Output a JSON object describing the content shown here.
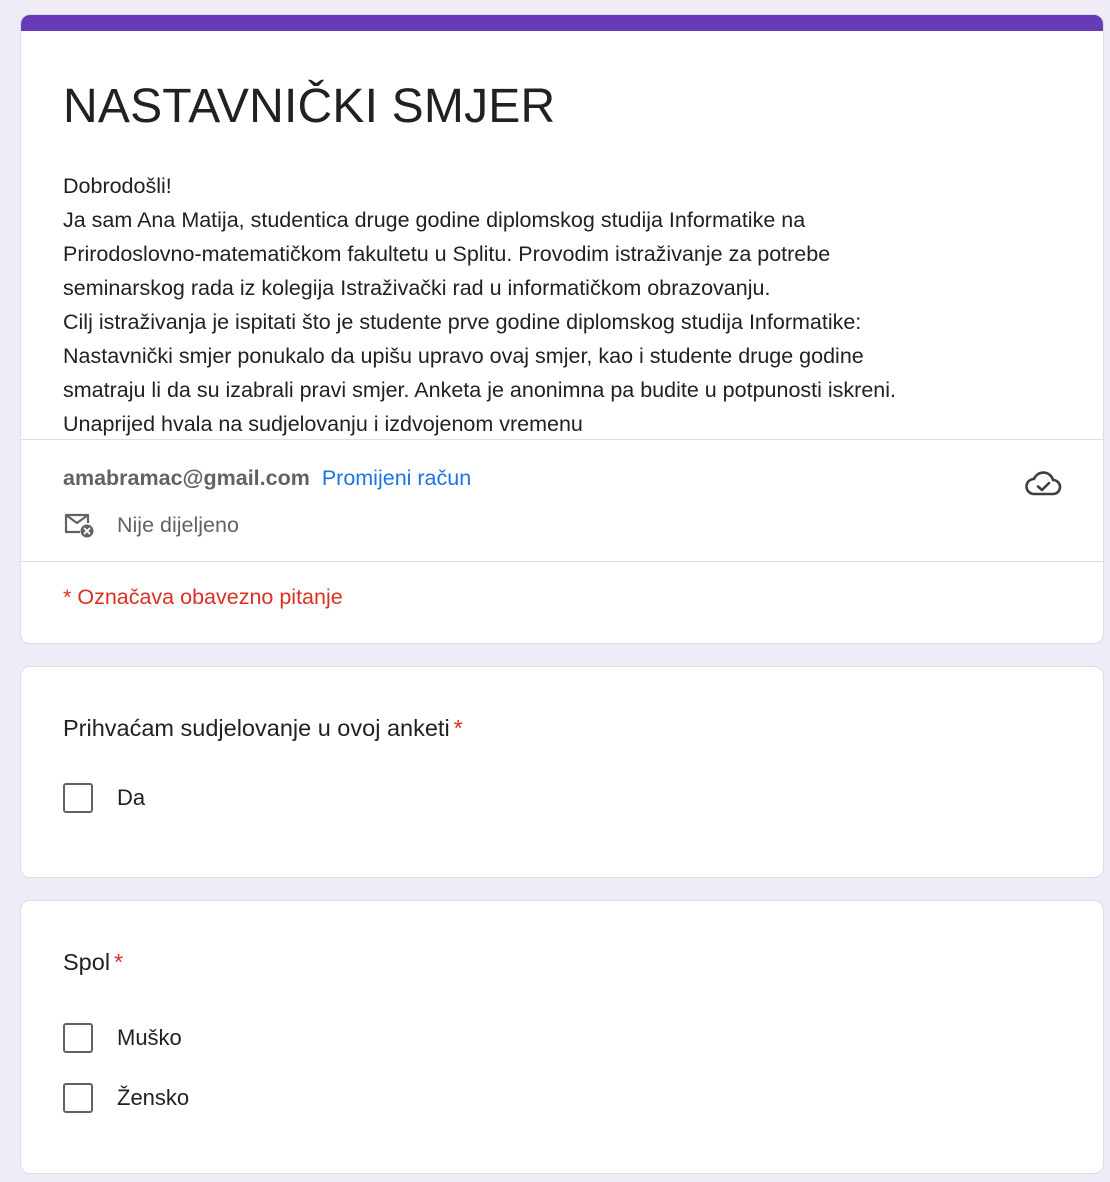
{
  "header": {
    "title": "NASTAVNIČKI SMJER",
    "description": [
      "Dobrodošli!",
      "Ja sam Ana Matija, studentica druge godine diplomskog studija Informatike na",
      "Prirodoslovno-matematičkom fakultetu u Splitu. Provodim istraživanje za potrebe",
      "seminarskog rada iz kolegija Istraživački rad u informatičkom obrazovanju.",
      "Cilj istraživanja je ispitati što je studente prve godine diplomskog studija Informatike:",
      "Nastavnički smjer ponukalo da upišu upravo ovaj smjer, kao i studente druge godine",
      "smatraju li da su izabrali pravi smjer. Anketa je anonimna pa budite u potpunosti iskreni.",
      "Unaprijed hvala na sudjelovanju i izdvojenom vremenu"
    ]
  },
  "account": {
    "email": "amabramac@gmail.com",
    "switch_label": "Promijeni račun",
    "share_status": "Nije dijeljeno",
    "icons": {
      "saved": "cloud-check-icon",
      "share": "mail-not-shared-icon"
    }
  },
  "required_note": "* Označava obavezno pitanje",
  "questions": [
    {
      "title": "Prihvaćam sudjelovanje u ovoj anketi",
      "required_mark": "*",
      "options": [
        "Da"
      ]
    },
    {
      "title": "Spol",
      "required_mark": "*",
      "options": [
        "Muško",
        "Žensko"
      ]
    }
  ],
  "colors": {
    "accent": "#673ab7",
    "background": "#efebf7",
    "required": "#d93025",
    "link": "#1a73e8"
  }
}
